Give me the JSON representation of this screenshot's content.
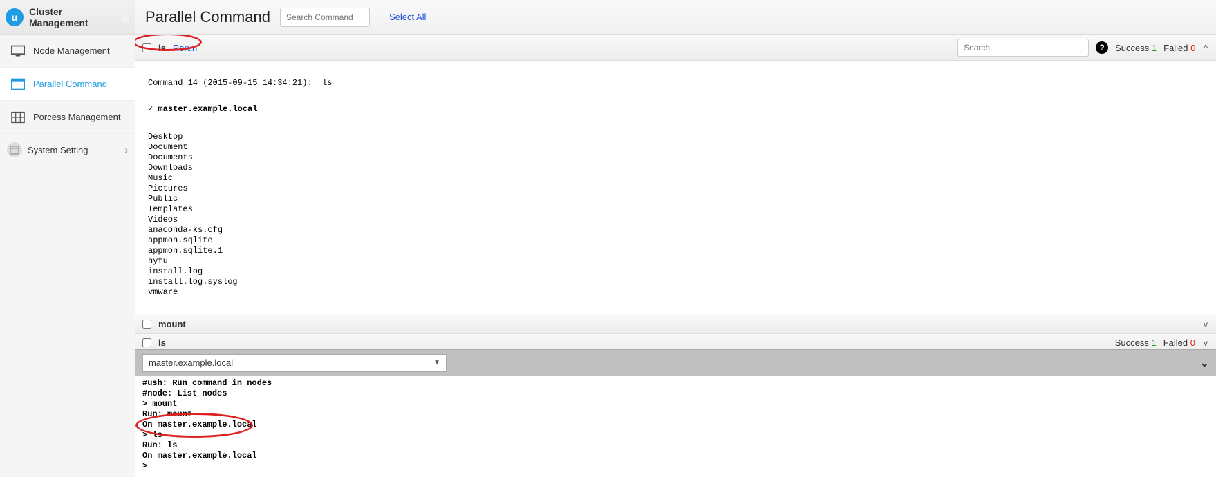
{
  "sidebar": {
    "title": "Cluster Management",
    "items": [
      {
        "label": "Node Management"
      },
      {
        "label": "Parallel Command"
      },
      {
        "label": "Porcess Management"
      }
    ],
    "system": {
      "label": "System Setting"
    }
  },
  "header": {
    "title": "Parallel Command",
    "search_placeholder": "Search Command",
    "select_all": "Select All"
  },
  "commands": [
    {
      "name": "ls",
      "rerun": "Rerun",
      "search_placeholder": "Search",
      "success_label": "Success",
      "success_count": "1",
      "failed_label": "Failed",
      "failed_count": "0",
      "expanded": true,
      "meta_line": "Command 14 (2015-09-15 14:34:21):  ls",
      "host_line": "✓ master.example.local",
      "output": "Desktop\nDocument\nDocuments\nDownloads\nMusic\nPictures\nPublic\nTemplates\nVideos\nanaconda-ks.cfg\nappmon.sqlite\nappmon.sqlite.1\nhyfu\ninstall.log\ninstall.log.syslog\nvmware"
    },
    {
      "name": "mount",
      "expanded": false
    },
    {
      "name": "ls",
      "success_label": "Success",
      "success_count": "1",
      "failed_label": "Failed",
      "failed_count": "0",
      "expanded": false
    }
  ],
  "bottom": {
    "node": "master.example.local",
    "terminal": "#ush: Run command in nodes\n#node: List nodes\n> mount\nRun: mount\nOn master.example.local\n> ls\nRun: ls\nOn master.example.local\n>"
  }
}
